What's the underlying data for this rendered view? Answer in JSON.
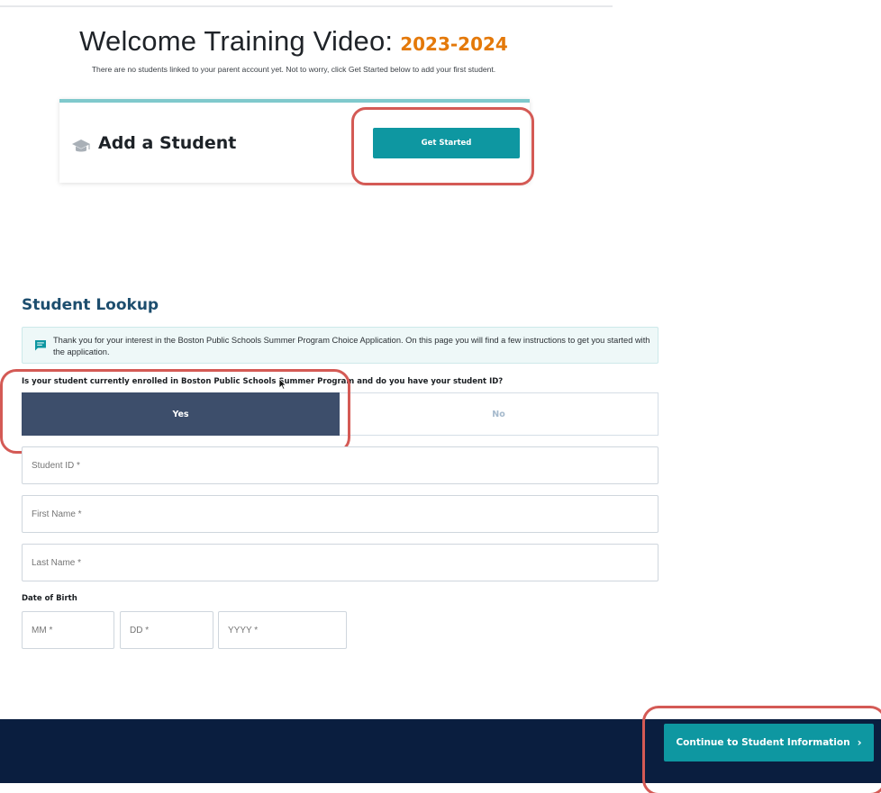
{
  "welcome": {
    "title": "Welcome Training Video:",
    "year": "2023-2024",
    "subtitle": "There are no students linked to your parent account yet. Not to worry, click Get Started below to add your first student."
  },
  "add_student_card": {
    "title": "Add a Student",
    "icon": "graduation-cap-icon",
    "button_label": "Get Started"
  },
  "student_lookup": {
    "title": "Student Lookup",
    "info_icon": "chat-message-icon",
    "info_text": "Thank you for your interest in the Boston Public Schools Summer Program Choice Application. On this page you will find a few instructions to get you started with the application.",
    "question": "Is your student currently enrolled in Boston Public Schools Summer Program and do you have your student ID?",
    "choices": [
      {
        "label": "Yes",
        "selected": true
      },
      {
        "label": "No",
        "selected": false
      }
    ],
    "fields": {
      "student_id": {
        "placeholder": "Student ID *",
        "value": ""
      },
      "first_name": {
        "placeholder": "First Name *",
        "value": ""
      },
      "last_name": {
        "placeholder": "Last Name *",
        "value": ""
      }
    },
    "dob": {
      "label": "Date of Birth",
      "month_placeholder": "MM *",
      "day_placeholder": "DD *",
      "year_placeholder": "YYYY *"
    }
  },
  "footer": {
    "continue_label": "Continue to Student Information",
    "continue_icon": "chevron-right-icon"
  },
  "colors": {
    "accent_teal": "#0e97a1",
    "year_orange": "#e4790a",
    "selected_choice": "#3d4e6b",
    "footer_navy": "#0a1e3f",
    "highlight_red": "#d45a55",
    "heading_blue": "#1d4e6e"
  }
}
